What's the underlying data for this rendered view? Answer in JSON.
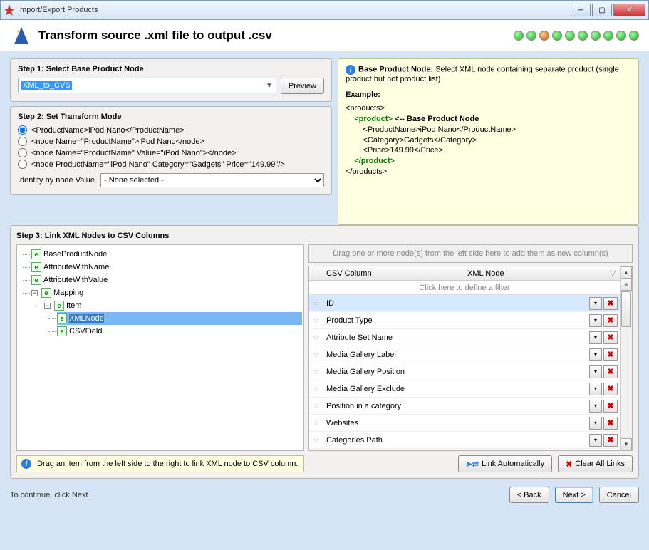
{
  "window": {
    "title": "Import/Export Products"
  },
  "header": {
    "title": "Transform source .xml file to output .csv"
  },
  "dots": [
    "green",
    "green",
    "orange",
    "green",
    "green",
    "green",
    "green",
    "green",
    "green",
    "green"
  ],
  "step1": {
    "legend": "Step 1: Select Base Product Node",
    "selected": "XML_to_CVS",
    "preview": "Preview"
  },
  "step2": {
    "legend": "Step 2: Set Transform Mode",
    "options": [
      "<ProductName>iPod Nano</ProductName>",
      "<node Name=\"ProductName\">iPod Nano</node>",
      "<node Name=\"ProductName\" Value=\"iPod Nano\"></node>",
      "<node ProductName=\"iPod Nano\" Category=\"Gadgets\" Price=\"149.99\"/>"
    ],
    "identify_label": "Identify by node Value",
    "identify_value": "- None selected -"
  },
  "info": {
    "title_bold": "Base Product Node:",
    "title_rest": " Select XML node containing separate product (single product but not product list)",
    "example_label": "Example:",
    "l1": "<products>",
    "l2": "    <product>",
    "l2b": " <-- Base Product Node",
    "l3": "        <ProductName>iPod Nano</ProductName>",
    "l4": "        <Category>Gadgets</Category>",
    "l5": "        <Price>149.99</Price>",
    "l6": "    </product>",
    "l7": "</products>"
  },
  "step3": {
    "legend": "Step 3: Link XML Nodes to CSV Columns",
    "tree": {
      "n0": "BaseProductNode",
      "n1": "AttributeWithName",
      "n2": "AttributeWithValue",
      "n3": "Mapping",
      "n4": "Item",
      "n5": "XMLNode",
      "n6": "CSVField"
    },
    "dropzone": "Drag one or more node(s) from the left side here to add them as new column(s)",
    "col1": "CSV Column",
    "col2": "XML Node",
    "filter": "Click here to define a filter",
    "rows": [
      "ID",
      "Product Type",
      "Attribute Set Name",
      "Media Gallery Label",
      "Media Gallery Position",
      "Media Gallery Exclude",
      "Position in a category",
      "Websites",
      "Categories Path"
    ],
    "hint": "Drag an item from the left side to the right to link XML node to CSV column."
  },
  "buttons": {
    "link_auto": "Link Automatically",
    "clear_all": "Clear All Links",
    "continue_note": "To continue, click Next",
    "back": "< Back",
    "next": "Next >",
    "cancel": "Cancel"
  }
}
